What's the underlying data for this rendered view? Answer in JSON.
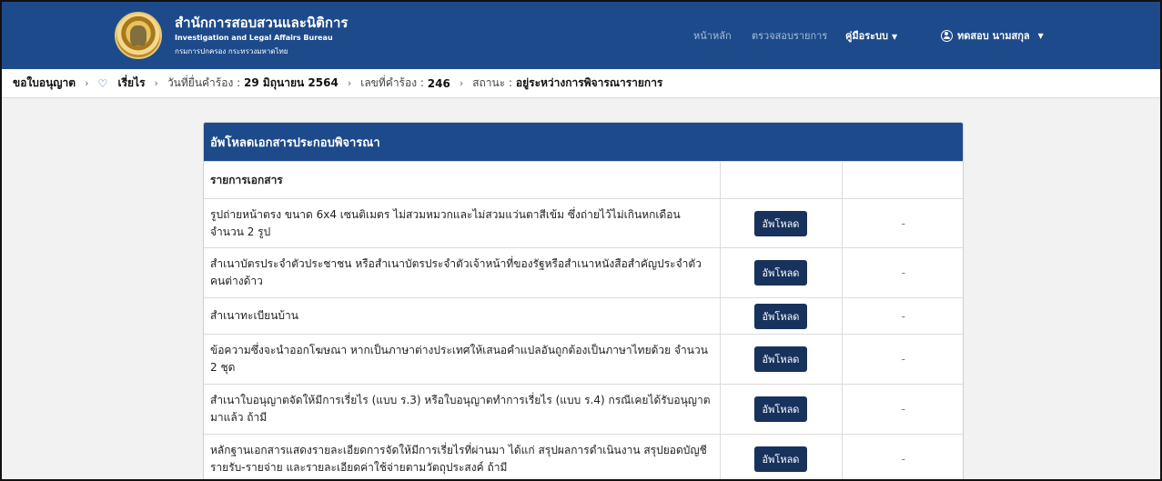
{
  "header": {
    "title": "สำนักการสอบสวนและนิติการ",
    "subtitle_en": "Investigation and Legal Affairs Bureau",
    "subtitle_th": "กรมการปกครอง กระทรวงมหาดไทย",
    "logo_icon": "department-seal",
    "nav": {
      "home": "หน้าหลัก",
      "check": "ตรวจสอบรายการ",
      "manual": "คู่มือระบบ",
      "user": "ทดสอบ นามสกุล"
    },
    "bg_color": "#1d4a8a"
  },
  "breadcrumb": {
    "item1": "ขอใบอนุญาต",
    "item2": "เรี่ยไร",
    "date_label": "วันที่ยื่นคำร้อง :",
    "date_value": "29 มิถุนายน 2564",
    "number_label": "เลขที่คำร้อง :",
    "number_value": "246",
    "status_label": "สถานะ :",
    "status_value": "อยู่ระหว่างการพิจารณารายการ"
  },
  "card": {
    "title": "อัพโหลดเอกสารประกอบพิจารณา",
    "column_header": "รายการเอกสาร",
    "upload_label": "อัพโหลด",
    "rows": [
      {
        "doc": "รูปถ่ายหน้าตรง ขนาด 6x4 เซนติเมตร ไม่สวมหมวกและไม่สวมแว่นตาสีเข้ม ซึ่งถ่ายไว้ไม่เกินหกเดือน จำนวน 2 รูป",
        "status": "-"
      },
      {
        "doc": "สำเนาบัตรประจำตัวประชาชน หรือสำเนาบัตรประจำตัวเจ้าหน้าที่ของรัฐหรือสำเนาหนังสือสำคัญประจำตัวคนต่างด้าว",
        "status": "-"
      },
      {
        "doc": "สำเนาทะเบียนบ้าน",
        "status": "-"
      },
      {
        "doc": "ข้อความซึ่งจะนำออกโฆษณา หากเป็นภาษาต่างประเทศให้เสนอคำแปลอันถูกต้องเป็นภาษาไทยด้วย จำนวน 2 ชุด",
        "status": "-"
      },
      {
        "doc": "สำเนาใบอนุญาตจัดให้มีการเรี่ยไร (แบบ ร.3) หรือใบอนุญาตทำการเรี่ยไร (แบบ ร.4) กรณีเคยได้รับอนุญาตมาแล้ว ถ้ามี",
        "status": "-"
      },
      {
        "doc": "หลักฐานเอกสารแสดงรายละเอียดการจัดให้มีการเรี่ยไรที่ผ่านมา ได้แก่ สรุปผลการดำเนินงาน สรุปยอดบัญชีรายรับ-รายจ่าย และรายละเอียดค่าใช้จ่ายตามวัตถุประสงค์ ถ้ามี",
        "status": "-"
      }
    ]
  }
}
